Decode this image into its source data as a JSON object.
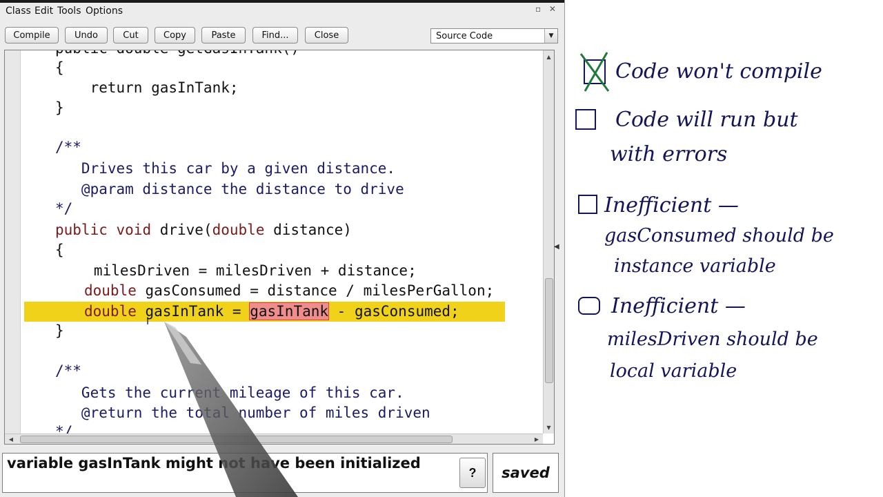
{
  "menu": {
    "class_label": "Class",
    "edit_label": "Edit",
    "tools_label": "Tools",
    "options_label": "Options"
  },
  "toolbar": {
    "compile_label": "Compile",
    "undo_label": "Undo",
    "cut_label": "Cut",
    "copy_label": "Copy",
    "paste_label": "Paste",
    "find_label": "Find...",
    "close_label": "Close",
    "view_selected": "Source Code"
  },
  "code": {
    "lines": [
      "public double getGasInTank()",
      "{",
      "    return gasInTank;",
      "}",
      "/**",
      "   Drives this car by a given distance.",
      "   @param distance the distance to drive",
      "*/",
      "{",
      "   milesDriven = milesDriven + distance;",
      "}",
      "/**",
      "   Gets the current mileage of this car.",
      "   @return the total number of miles driven",
      "*/"
    ],
    "drive_sig": {
      "kw_public": "public",
      "kw_void": "void",
      "name": " drive(",
      "kw_double": "double",
      "rest": " distance)"
    },
    "gas_consumed": {
      "kw_double": "double",
      "rest": " gasConsumed = distance / milesPerGallon;"
    },
    "gas_in_tank": {
      "kw_double": "double",
      "mid": " gasInTank = ",
      "error_token": "gasInTank",
      "rest": " - gasConsumed;"
    }
  },
  "message": {
    "text": "variable gasInTank might not have been initialized",
    "help_label": "?"
  },
  "status": {
    "text": "saved"
  },
  "notes": {
    "option1": "Code won't compile",
    "option2_line1": "Code will run but",
    "option2_line2": "with errors",
    "option3_line1": "Inefficient —",
    "option3_line2": "gasConsumed should be",
    "option3_line3": "instance variable",
    "option4_line1": "Inefficient —",
    "option4_line2": "milesDriven should be",
    "option4_line3": "local variable"
  },
  "colors": {
    "highlight": "#f0d21a",
    "error_token": "#ef8c8c",
    "ink": "#14145a",
    "check": "#1e7a3a"
  }
}
